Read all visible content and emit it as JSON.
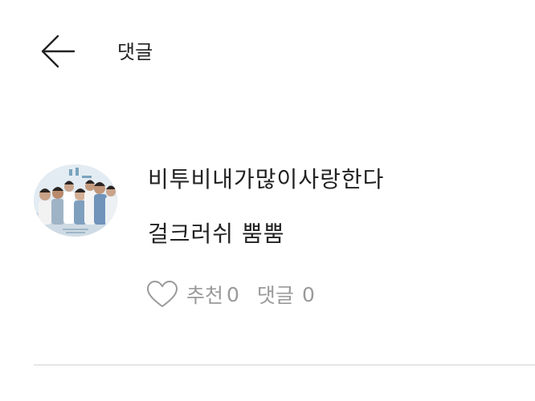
{
  "header": {
    "title": "댓글",
    "back_icon": "arrow-left-icon"
  },
  "comment": {
    "author": "비투비내가많이사랑한다",
    "text": "걸크러쉬 뿜뿜",
    "like_label": "추천",
    "like_count": "0",
    "reply_label": "댓글",
    "reply_count": "0",
    "like_icon": "heart-outline-icon"
  },
  "colors": {
    "text": "#222222",
    "muted": "#9a9a9a",
    "divider": "#e6e6e6",
    "background": "#ffffff"
  }
}
